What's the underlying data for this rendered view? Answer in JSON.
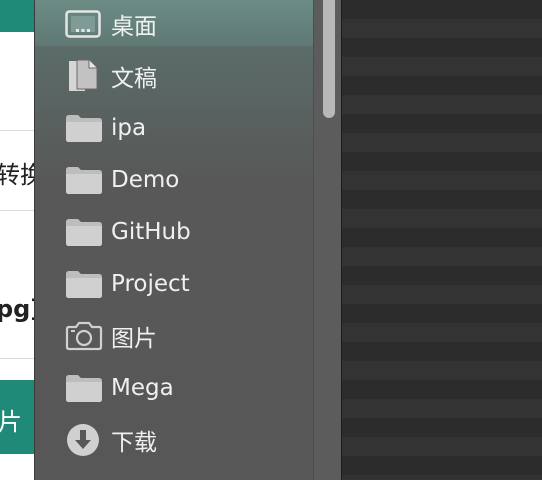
{
  "background_app": {
    "texts": [
      "转换",
      "pg]",
      "片"
    ]
  },
  "sidebar": {
    "items": [
      {
        "label": "桌面",
        "icon": "desktop-icon",
        "selected": true
      },
      {
        "label": "文稿",
        "icon": "document-icon"
      },
      {
        "label": "ipa",
        "icon": "folder-icon"
      },
      {
        "label": "Demo",
        "icon": "folder-icon"
      },
      {
        "label": "GitHub",
        "icon": "folder-icon"
      },
      {
        "label": "Project",
        "icon": "folder-icon"
      },
      {
        "label": "图片",
        "icon": "camera-icon"
      },
      {
        "label": "Mega",
        "icon": "folder-icon"
      },
      {
        "label": "下载",
        "icon": "download-icon"
      }
    ]
  },
  "colors": {
    "accent_teal": "#1f8a78",
    "sidebar_bg": "#585858",
    "label_text": "#f0f0f0"
  }
}
